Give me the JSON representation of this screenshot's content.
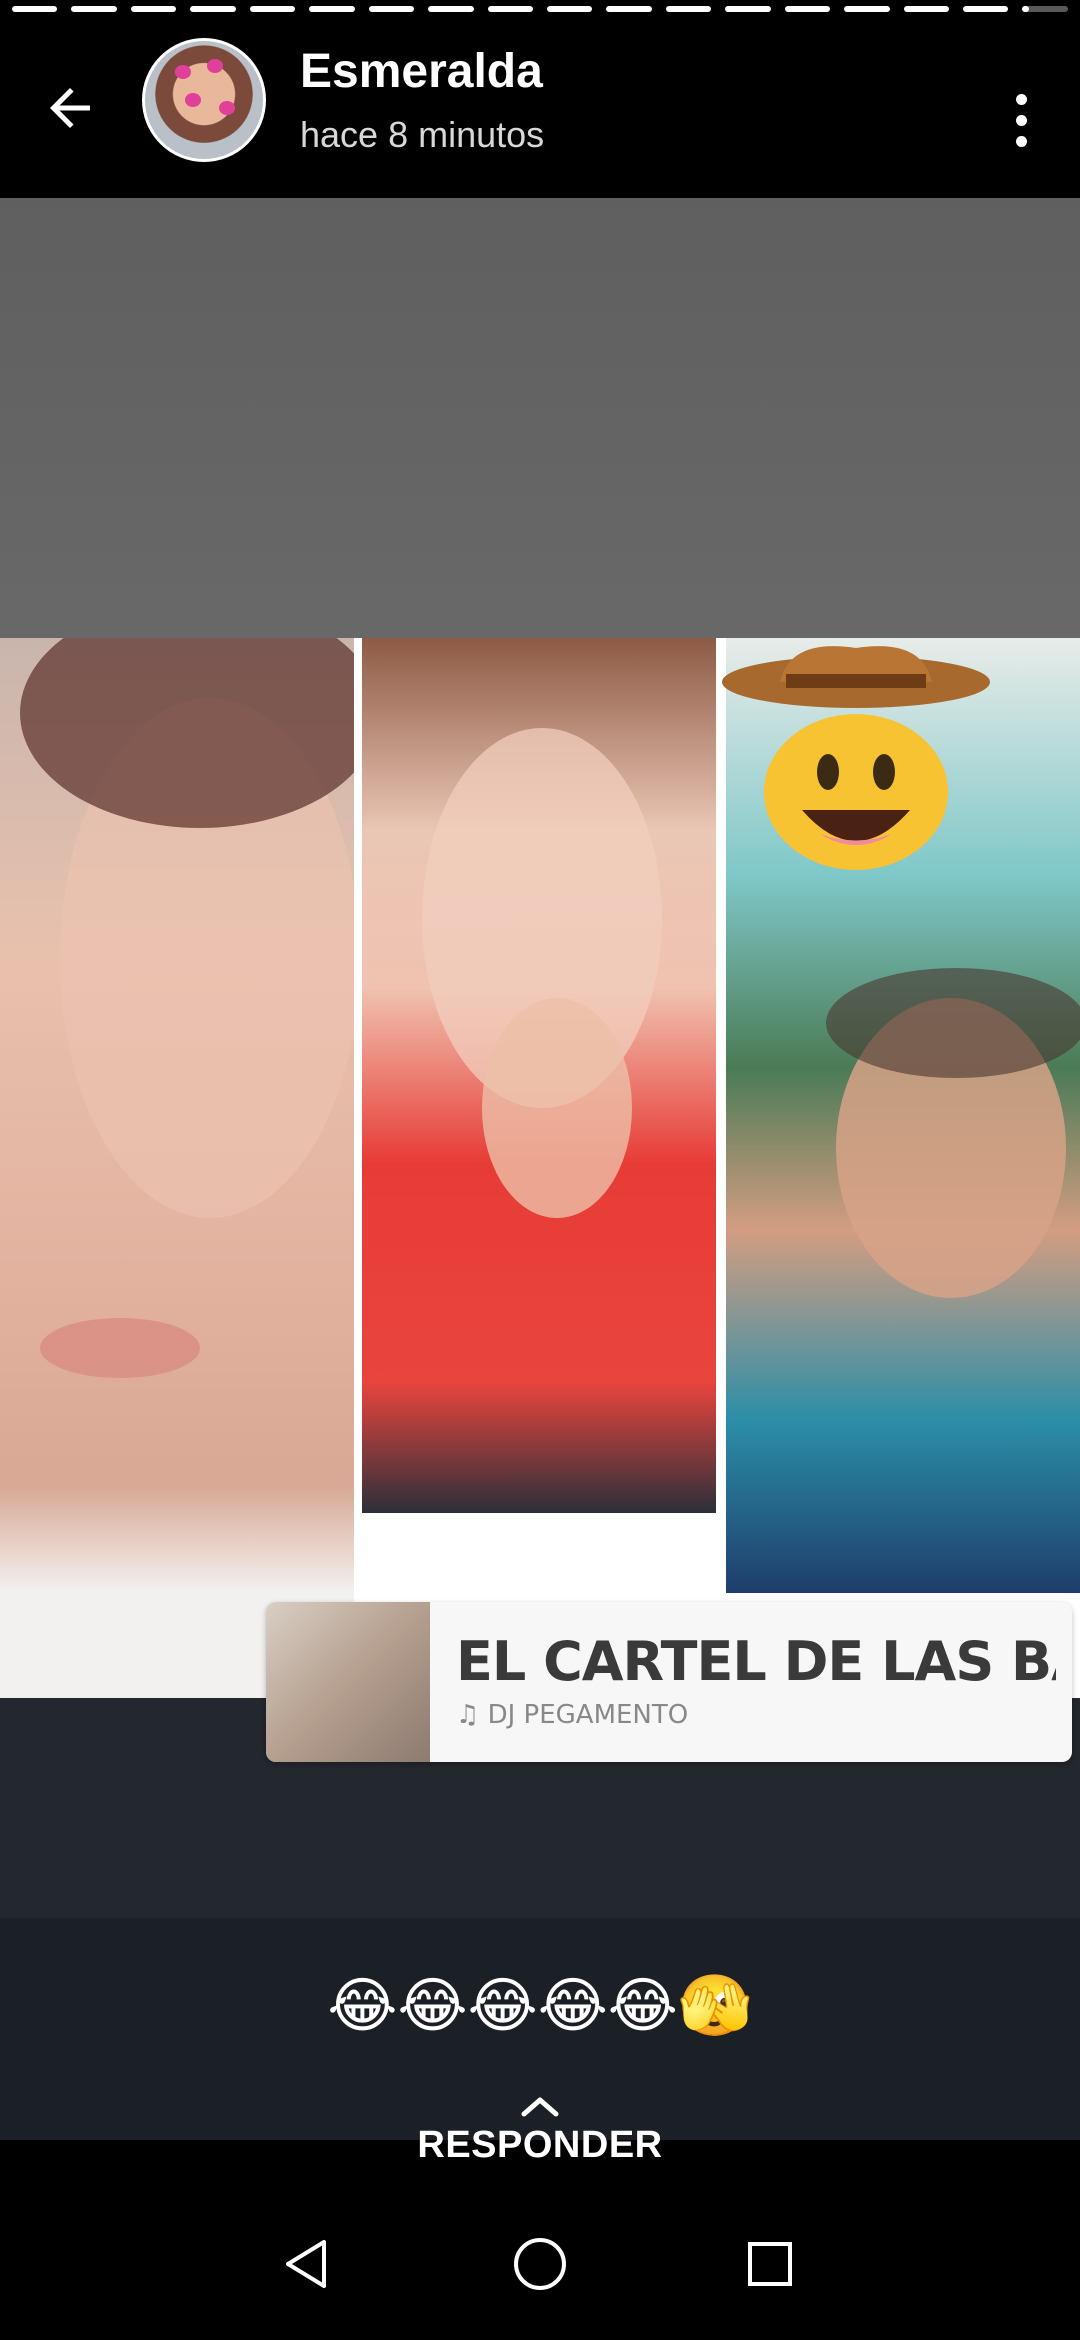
{
  "story": {
    "user_name": "Esmeralda",
    "timestamp": "hace 8 minutos",
    "segments_total": 18,
    "current_progress": 0.15
  },
  "media": {
    "music_sticker": {
      "title": "EL CARTEL DE LAS BABYS L/",
      "artist": "DJ PEGAMENTO"
    },
    "sticker_emoji": "🤠"
  },
  "caption": {
    "text": "😂😂😂😂😂🫣"
  },
  "reply": {
    "label": "RESPONDER"
  },
  "icons": {
    "back": "arrow-back-icon",
    "menu": "more-vert-icon",
    "chevron": "chevron-up-icon",
    "nav_back": "nav-back-icon",
    "nav_home": "nav-home-icon",
    "nav_recents": "nav-recents-icon"
  },
  "colors": {
    "background": "#000000",
    "caption_bg": "#1b1f26",
    "text": "#ffffff"
  }
}
